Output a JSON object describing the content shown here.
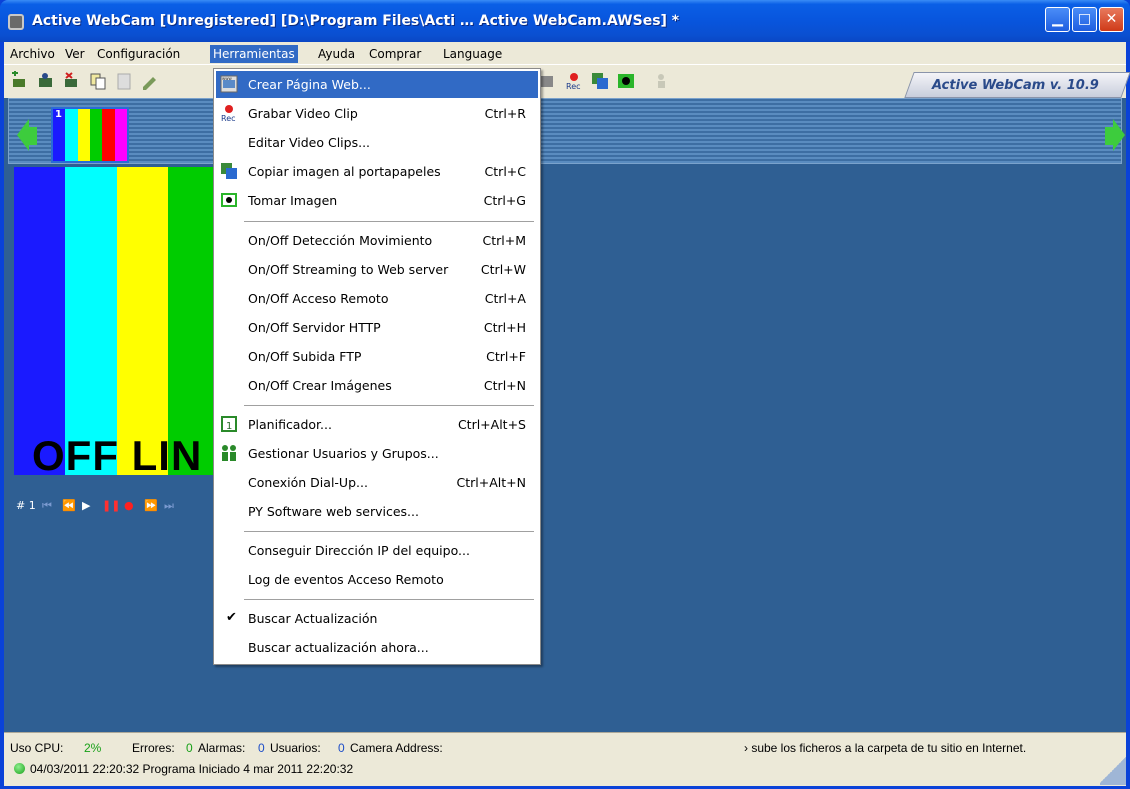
{
  "window": {
    "title": "Active WebCam [Unregistered] [D:\\Program Files\\Acti … Active WebCam.AWSes] *",
    "min_label": "▁",
    "max_label": "□",
    "close_label": "✕"
  },
  "menubar": {
    "items": [
      "Archivo",
      "Ver",
      "Configuración",
      "Herramientas",
      "Ayuda",
      "Comprar",
      "Language"
    ]
  },
  "toolbar": {
    "version": "Active WebCam v. 10.9"
  },
  "camera": {
    "thumb_number": "1",
    "offline_text": "OFF LIN",
    "player_label": "# 1"
  },
  "menu_herramientas": {
    "items": [
      {
        "label": "Crear Página Web...",
        "shortcut": "",
        "icon": "web-page-icon"
      },
      {
        "label": "Grabar Video Clip",
        "shortcut": "Ctrl+R",
        "icon": "record-icon"
      },
      {
        "label": "Editar Video Clips...",
        "shortcut": ""
      },
      {
        "label": "Copiar imagen al portapapeles",
        "shortcut": "Ctrl+C",
        "icon": "copy-image-icon"
      },
      {
        "label": "Tomar Imagen",
        "shortcut": "Ctrl+G",
        "icon": "camera-icon"
      },
      {
        "label": "On/Off Detección Movimiento",
        "shortcut": "Ctrl+M"
      },
      {
        "label": "On/Off Streaming to Web server",
        "shortcut": "Ctrl+W"
      },
      {
        "label": "On/Off Acceso Remoto",
        "shortcut": "Ctrl+A"
      },
      {
        "label": "On/Off Servidor HTTP",
        "shortcut": "Ctrl+H"
      },
      {
        "label": "On/Off Subida FTP",
        "shortcut": "Ctrl+F"
      },
      {
        "label": "On/Off Crear Imágenes",
        "shortcut": "Ctrl+N"
      },
      {
        "label": "Planificador...",
        "shortcut": "Ctrl+Alt+S",
        "icon": "calendar-icon"
      },
      {
        "label": "Gestionar Usuarios y Grupos...",
        "shortcut": "",
        "icon": "users-icon"
      },
      {
        "label": "Conexión Dial-Up...",
        "shortcut": "Ctrl+Alt+N"
      },
      {
        "label": "PY Software web services...",
        "shortcut": ""
      },
      {
        "label": "Conseguir Dirección IP del equipo...",
        "shortcut": ""
      },
      {
        "label": "Log de eventos Acceso Remoto",
        "shortcut": ""
      },
      {
        "label": "Buscar Actualización",
        "shortcut": "",
        "checked": true
      },
      {
        "label": "Buscar actualización ahora...",
        "shortcut": ""
      }
    ]
  },
  "status": {
    "cpu_label": "Uso CPU:",
    "cpu_value": "2%",
    "errors_label": "Errores:",
    "errors_value": "0",
    "alarms_label": "Alarmas:",
    "alarms_value": "0",
    "users_label": "Usuarios:",
    "users_value": "0",
    "camera_address_label": "Camera Address:",
    "hint": "› sube los ficheros a la carpeta de tu sitio en Internet.",
    "log": "04/03/2011 22:20:32   Programa Iniciado  4 mar 2011 22:20:32"
  },
  "colors": {
    "menu_highlight": "#316ac5",
    "main_bg": "#2f5f93",
    "stripe_colors": [
      "#1a1aff",
      "#00ffff",
      "#ffff00",
      "#00cc00",
      "#ff00ff"
    ]
  }
}
